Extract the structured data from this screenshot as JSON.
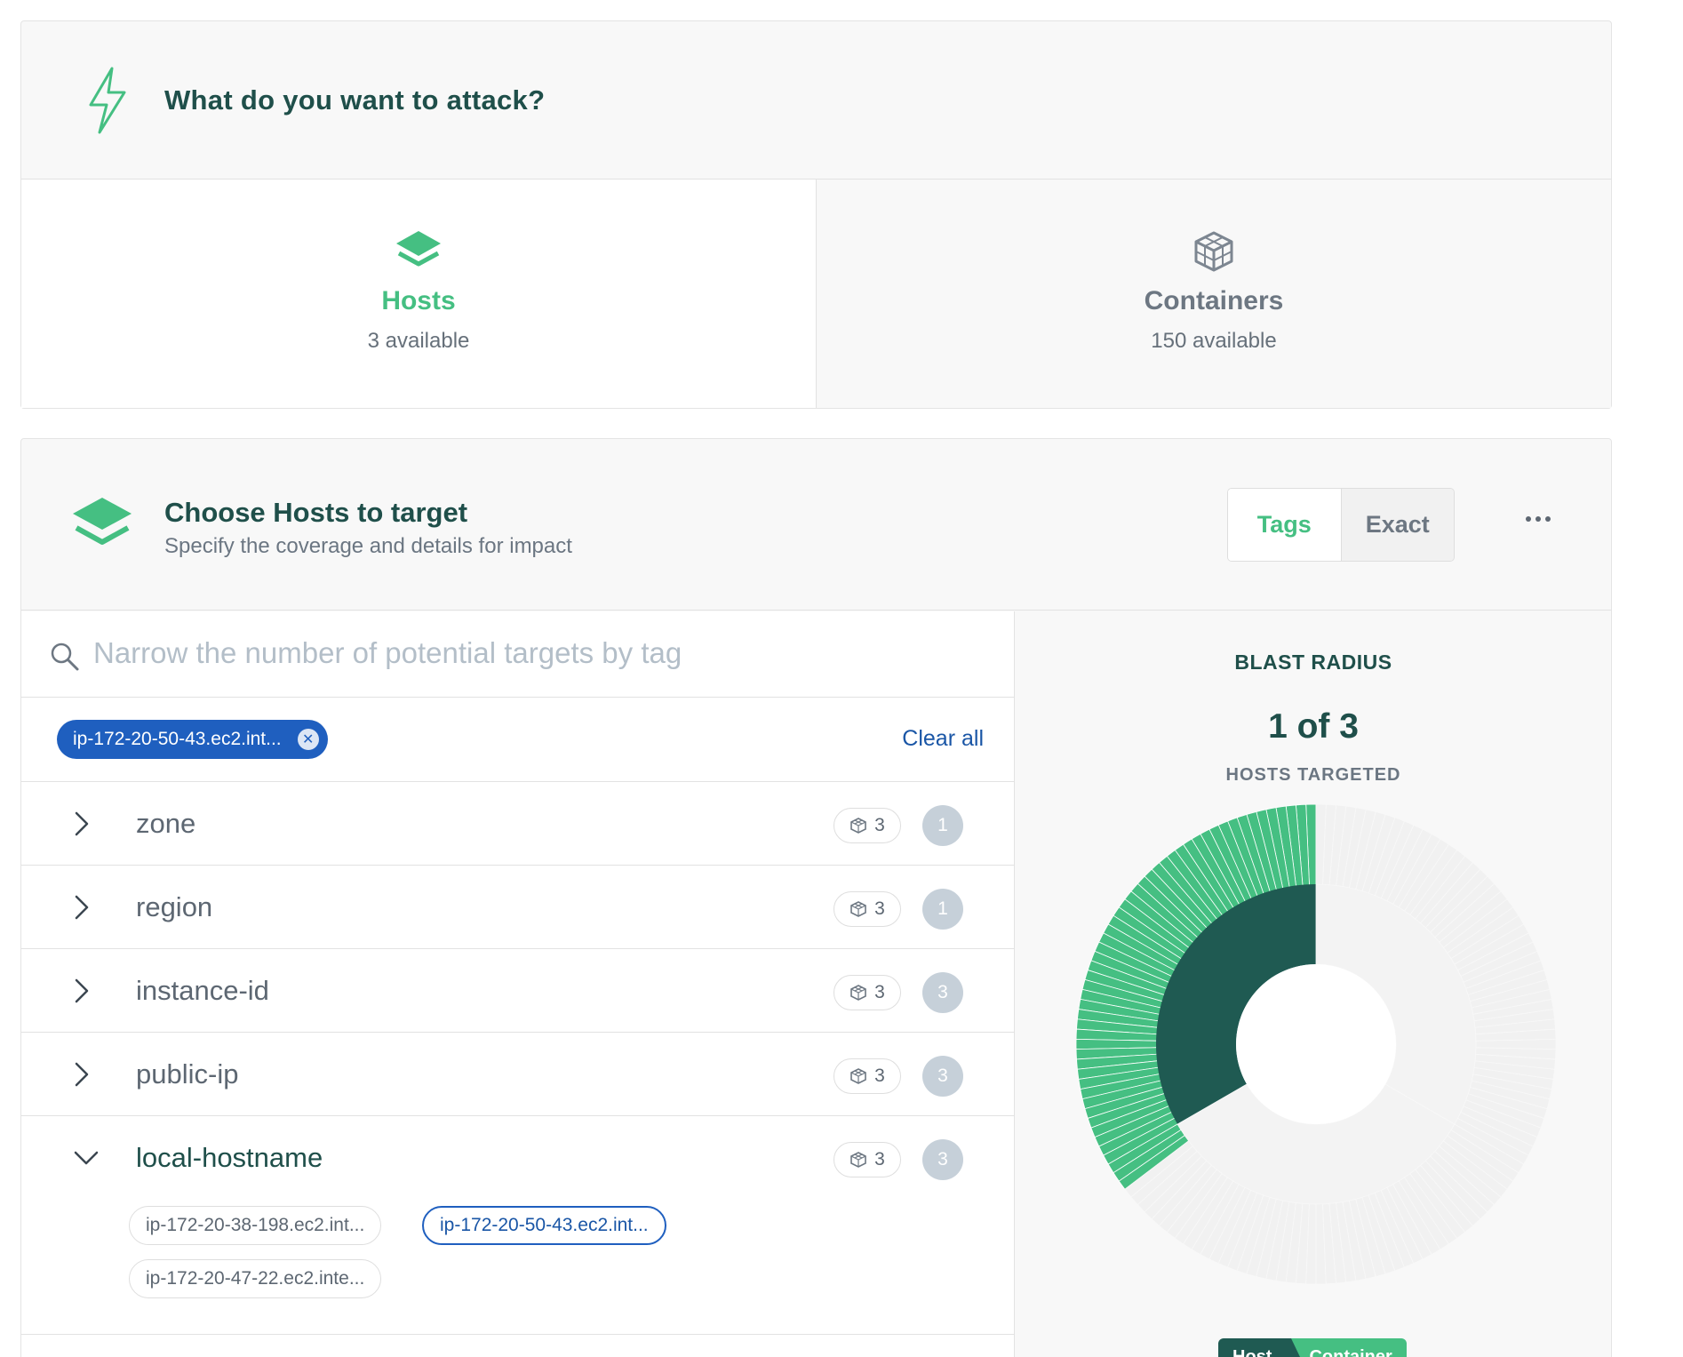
{
  "attack": {
    "title": "What do you want to attack?",
    "icon": "lightning-bolt-icon",
    "targets": [
      {
        "name": "Hosts",
        "available": "3 available",
        "icon": "layers-icon",
        "active": true
      },
      {
        "name": "Containers",
        "available": "150 available",
        "icon": "container-cube-icon",
        "active": false
      }
    ]
  },
  "choose": {
    "title": "Choose Hosts to target",
    "subtitle": "Specify the coverage and details for impact",
    "mode_tabs": [
      "Tags",
      "Exact"
    ],
    "active_mode": "Tags",
    "more_icon": "more-horizontal-icon"
  },
  "search": {
    "placeholder": "Narrow the number of potential targets by tag",
    "value": ""
  },
  "selected_chips": [
    {
      "label": "ip-172-20-50-43.ec2.int..."
    }
  ],
  "clear_all_label": "Clear all",
  "tags": [
    {
      "name": "zone",
      "containers": "3",
      "hosts": "1",
      "expanded": false
    },
    {
      "name": "region",
      "containers": "3",
      "hosts": "1",
      "expanded": false
    },
    {
      "name": "instance-id",
      "containers": "3",
      "hosts": "3",
      "expanded": false
    },
    {
      "name": "public-ip",
      "containers": "3",
      "hosts": "3",
      "expanded": false
    },
    {
      "name": "local-hostname",
      "containers": "3",
      "hosts": "3",
      "expanded": true,
      "values": [
        {
          "label": "ip-172-20-38-198.ec2.int...",
          "selected": false
        },
        {
          "label": "ip-172-20-50-43.ec2.int...",
          "selected": true
        },
        {
          "label": "ip-172-20-47-22.ec2.inte...",
          "selected": false
        }
      ]
    }
  ],
  "blast_radius": {
    "title": "BLAST RADIUS",
    "count": "1 of 3",
    "subtitle": "HOSTS TARGETED",
    "hosts_targeted": 1,
    "hosts_total": 3,
    "containers_targeted": 53,
    "containers_total": 150,
    "legend": [
      "Host",
      "Container"
    ],
    "colors": {
      "host": "#1f5a52",
      "container": "#45bf82",
      "untargeted": "#f1f1f1",
      "accent": "#45bf82",
      "selected_chip": "#1f5fbf"
    }
  }
}
